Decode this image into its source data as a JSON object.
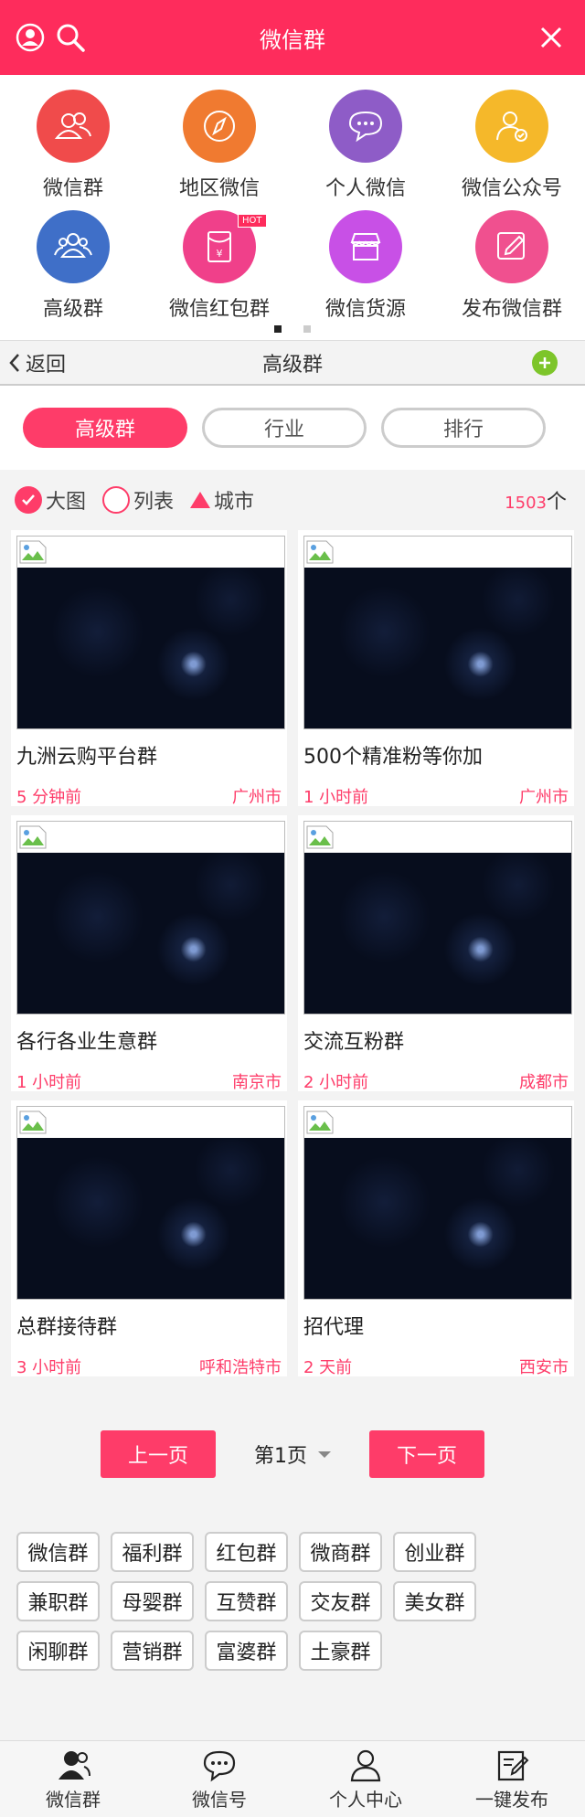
{
  "header": {
    "title": "微信群"
  },
  "categories": [
    {
      "label": "微信群",
      "icon": "group-icon",
      "color": "#f04b4b"
    },
    {
      "label": "地区微信",
      "icon": "compass-icon",
      "color": "#f07a30"
    },
    {
      "label": "个人微信",
      "icon": "chat-icon",
      "color": "#8e5cc7"
    },
    {
      "label": "微信公众号",
      "icon": "official-account-icon",
      "color": "#f5b82a"
    },
    {
      "label": "高级群",
      "icon": "premium-group-icon",
      "color": "#3f6fc8"
    },
    {
      "label": "微信红包群",
      "icon": "red-packet-icon",
      "color": "#f0408a",
      "badge": "HOT"
    },
    {
      "label": "微信货源",
      "icon": "store-icon",
      "color": "#c850e6"
    },
    {
      "label": "发布微信群",
      "icon": "edit-icon",
      "color": "#f0508f"
    }
  ],
  "subnav": {
    "back_label": "返回",
    "title": "高级群"
  },
  "tabs": [
    {
      "label": "高级群",
      "active": true
    },
    {
      "label": "行业",
      "active": false
    },
    {
      "label": "排行",
      "active": false
    }
  ],
  "filter": {
    "large_label": "大图",
    "list_label": "列表",
    "city_label": "城市",
    "count": "1503",
    "count_unit": "个"
  },
  "cards": [
    {
      "title": "九洲云购平台群",
      "time": "5 分钟前",
      "city": "广州市"
    },
    {
      "title": "500个精准粉等你加",
      "time": "1 小时前",
      "city": "广州市"
    },
    {
      "title": "各行各业生意群",
      "time": "1 小时前",
      "city": "南京市"
    },
    {
      "title": "交流互粉群",
      "time": "2 小时前",
      "city": "成都市"
    },
    {
      "title": "总群接待群",
      "time": "3 小时前",
      "city": "呼和浩特市"
    },
    {
      "title": "招代理",
      "time": "2 天前",
      "city": "西安市"
    }
  ],
  "pager": {
    "prev_label": "上一页",
    "current": "第1页",
    "next_label": "下一页"
  },
  "tags": [
    "微信群",
    "福利群",
    "红包群",
    "微商群",
    "创业群",
    "兼职群",
    "母婴群",
    "互赞群",
    "交友群",
    "美女群",
    "闲聊群",
    "营销群",
    "富婆群",
    "土豪群"
  ],
  "bottom_nav": [
    {
      "label": "微信群",
      "icon": "user-group-icon"
    },
    {
      "label": "微信号",
      "icon": "chat-bubble-icon"
    },
    {
      "label": "个人中心",
      "icon": "person-icon"
    },
    {
      "label": "一键发布",
      "icon": "publish-icon"
    }
  ]
}
